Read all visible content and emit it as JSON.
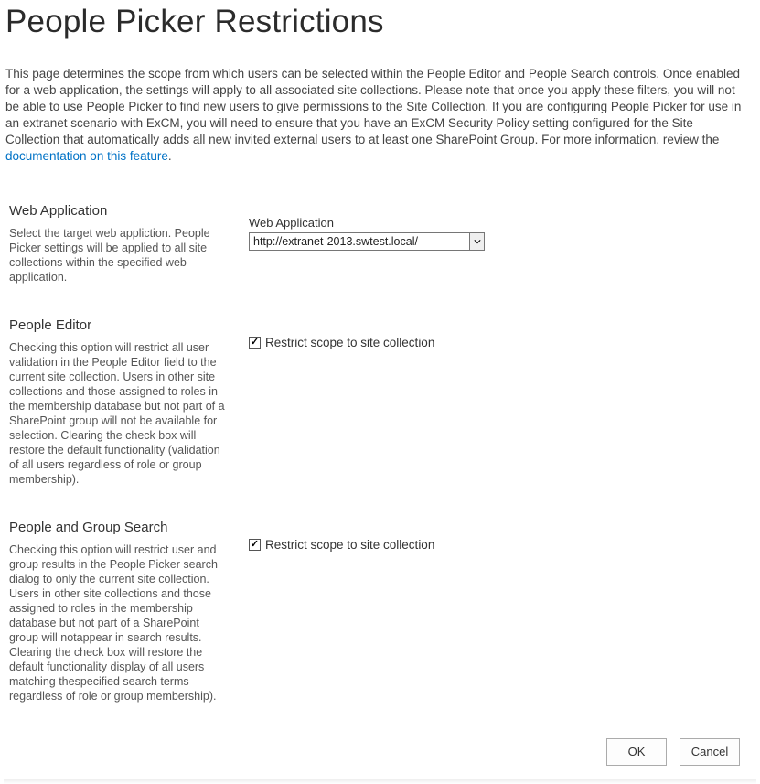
{
  "page": {
    "title": "People Picker Restrictions",
    "intro_prefix": "This page determines the scope from which users can be selected within the People Editor and People Search controls. Once enabled for a web application, the settings will apply to all associated site collections. Please note that once you apply these filters, you will not be able to use People Picker to find new users to give permissions to the Site Collection. If you are configuring People Picker for use in an extranet scenario with ExCM, you will need to ensure that you have an ExCM Security Policy setting configured for the Site Collection that automatically adds all new invited external users to at least one SharePoint Group. For more information, review the ",
    "intro_link_text": "documentation on this feature",
    "intro_suffix": "."
  },
  "sections": {
    "web_app": {
      "heading": "Web Application",
      "description": "Select the target web appliction. People Picker settings will be applied to all site collections within the specified web application.",
      "field_label": "Web Application",
      "selected_value": "http://extranet-2013.swtest.local/"
    },
    "people_editor": {
      "heading": "People Editor",
      "description": "Checking this option will restrict all user validation in the People Editor field to the current site collection. Users in other site collections and those assigned to roles in the membership database but not part of a SharePoint group will not be available for selection. Clearing the check box will restore the default functionality (validation of all users regardless of role or group membership).",
      "checkbox_label": "Restrict scope to site collection",
      "checked": true
    },
    "people_search": {
      "heading": "People and Group Search",
      "description": "Checking this option will restrict user and group results in the People Picker search dialog to only the current site collection. Users in other site collections and those assigned to roles in the membership database but not part of a SharePoint group will notappear in search results. Clearing the check box will restore the default functionality display of all users matching thespecified search terms regardless of role or group membership).",
      "checkbox_label": "Restrict scope to site collection",
      "checked": true
    }
  },
  "buttons": {
    "ok": "OK",
    "cancel": "Cancel"
  }
}
